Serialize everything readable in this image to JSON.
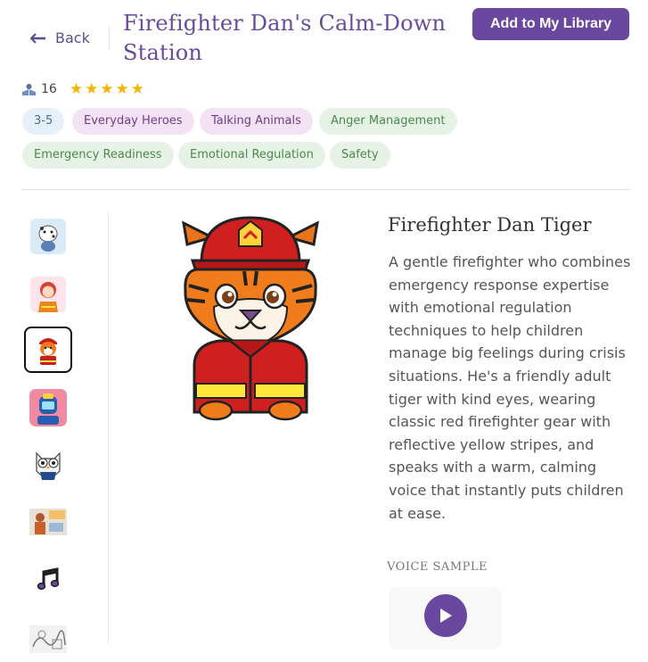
{
  "header": {
    "back_label": "Back",
    "title": "Firefighter Dan's Calm-Down Station",
    "add_button_label": "Add to My Library"
  },
  "meta": {
    "count": "16",
    "rating": 5,
    "stars_text": "★★★★★"
  },
  "tags": [
    {
      "label": "3-5",
      "style": "blue"
    },
    {
      "label": "Everyday Heroes",
      "style": "purple"
    },
    {
      "label": "Talking Animals",
      "style": "purple"
    },
    {
      "label": "Anger Management",
      "style": "green"
    },
    {
      "label": "Emergency Readiness",
      "style": "green"
    },
    {
      "label": "Emotional Regulation",
      "style": "green"
    },
    {
      "label": "Safety",
      "style": "green"
    }
  ],
  "sidebar": {
    "thumbnails": [
      {
        "icon": "dalmatian-dog-icon",
        "selected": false
      },
      {
        "icon": "red-haired-firefighter-icon",
        "selected": false
      },
      {
        "icon": "firefighter-tiger-icon",
        "selected": true
      },
      {
        "icon": "robot-helmet-icon",
        "selected": false
      },
      {
        "icon": "owl-icon",
        "selected": false
      },
      {
        "icon": "scene-illustration-icon",
        "selected": false
      },
      {
        "icon": "music-note-icon",
        "selected": false
      },
      {
        "icon": "sketch-illustration-icon",
        "selected": false
      }
    ]
  },
  "character": {
    "name": "Firefighter Dan Tiger",
    "description": "A gentle firefighter who combines emergency response expertise with emotional regulation techniques to help children manage big feelings during crisis situations. He's a friendly adult tiger with kind eyes, wearing classic red firefighter gear with reflective yellow stripes, and speaks with a warm, calming voice that instantly puts children at ease."
  },
  "voice": {
    "label": "VOICE SAMPLE"
  },
  "colors": {
    "brand_purple": "#6b48a0",
    "title_purple": "#6a4b9a",
    "star_yellow": "#f5b400"
  }
}
